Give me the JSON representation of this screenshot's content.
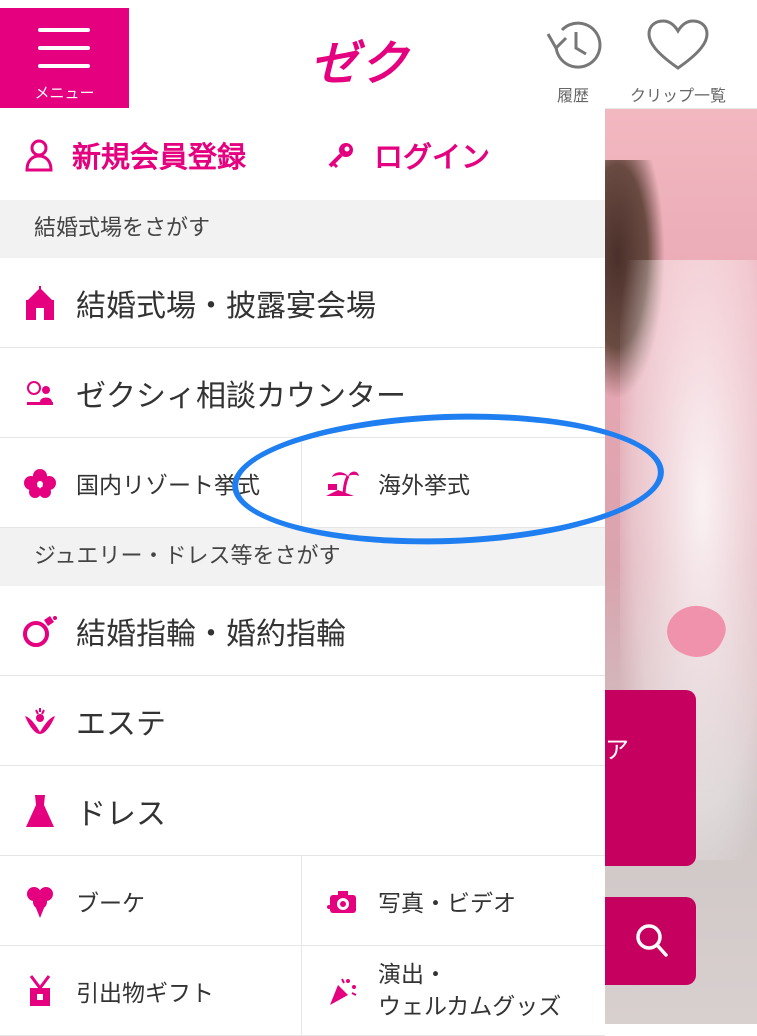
{
  "header": {
    "menu_label": "メニュー",
    "logo_text": "ゼクシィ",
    "history_label": "履歴",
    "clip_label": "クリップ一覧"
  },
  "auth": {
    "register_label": "新規会員登録",
    "login_label": "ログイン"
  },
  "sections": {
    "venue_header": "結婚式場をさがす",
    "jewelry_header": "ジュエリー・ドレス等をさがす"
  },
  "menu_items": {
    "venue": "結婚式場・披露宴会場",
    "counter": "ゼクシィ相談カウンター",
    "resort": "国内リゾート挙式",
    "overseas": "海外挙式",
    "rings": "結婚指輪・婚約指輪",
    "esthe": "エステ",
    "dress": "ドレス",
    "bouquet": "ブーケ",
    "photo": "写真・ビデオ",
    "gift": "引出物ギフト",
    "welcome_line1": "演出・",
    "welcome_line2": "ウェルカムグッズ"
  },
  "background": {
    "card_text": "ア"
  },
  "colors": {
    "brand": "#e4007f",
    "annotation": "#1f7ff0"
  }
}
